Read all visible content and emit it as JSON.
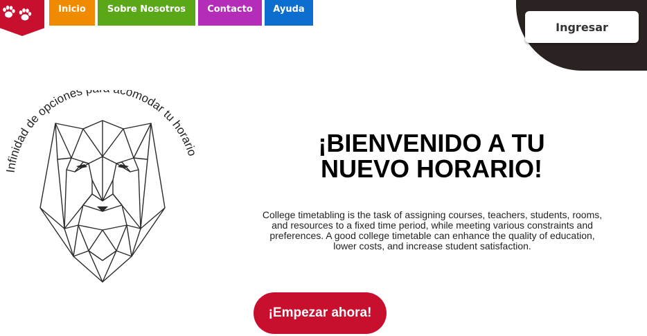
{
  "brand": {
    "logo_icon": "paw-print-icon",
    "color": "#c8102e"
  },
  "nav": {
    "items": [
      {
        "label": "Inicio",
        "color": "#f08a00"
      },
      {
        "label": "Sobre Nosotros",
        "color": "#5aa817"
      },
      {
        "label": "Contacto",
        "color": "#b42cb7"
      },
      {
        "label": "Ayuda",
        "color": "#0c6fcf"
      }
    ]
  },
  "header": {
    "login_label": "Ingresar",
    "login_bg": "#2b2321"
  },
  "hero": {
    "art_text": "Infinidad de opciones para acomodar tu horario",
    "title": "¡BIENVENIDO A TU NUEVO HORARIO!",
    "description": "College timetabling is the task of assigning courses, teachers, students, rooms, and resources to a fixed time period, while meeting various constraints and preferences. A good college timetable can enhance the quality of education, lower costs, and increase student satisfaction.",
    "cta_label": "¡Empezar ahora!"
  }
}
